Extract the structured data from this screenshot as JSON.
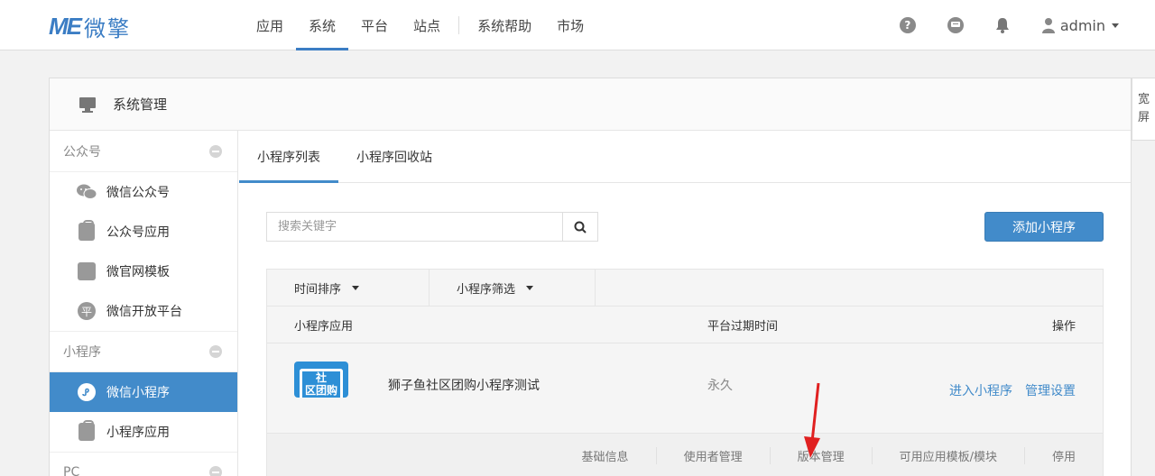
{
  "header": {
    "logo_mark": "ME",
    "logo_text": "微擎",
    "nav": [
      "应用",
      "系统",
      "平台",
      "站点",
      "系统帮助",
      "市场"
    ],
    "active_nav": "系统",
    "user": "admin",
    "help_glyph": "?",
    "icons": [
      "question-icon",
      "message-icon",
      "bell-icon",
      "user-icon"
    ]
  },
  "panel": {
    "title": "系统管理"
  },
  "sidebar": {
    "groups": [
      {
        "label": "公众号",
        "items": [
          {
            "label": "微信公众号",
            "icon": "wechat-icon"
          },
          {
            "label": "公众号应用",
            "icon": "bag-icon"
          },
          {
            "label": "微官网模板",
            "icon": "template-icon"
          },
          {
            "label": "微信开放平台",
            "icon": "platform-icon",
            "glyph": "平"
          }
        ]
      },
      {
        "label": "小程序",
        "items": [
          {
            "label": "微信小程序",
            "icon": "miniprogram-icon",
            "active": true
          },
          {
            "label": "小程序应用",
            "icon": "bag-icon"
          }
        ]
      },
      {
        "label": "PC",
        "items": []
      }
    ]
  },
  "tabs": [
    "小程序列表",
    "小程序回收站"
  ],
  "search": {
    "placeholder": "搜索关键字"
  },
  "add_button": "添加小程序",
  "filters": [
    "时间排序",
    "小程序筛选"
  ],
  "table": {
    "headers": [
      "小程序应用",
      "平台过期时间",
      "操作"
    ],
    "rows": [
      {
        "name": "狮子鱼社区团购小程序测试",
        "expire": "永久",
        "icon_text": "社\n区团购",
        "actions": [
          "进入小程序",
          "管理设置"
        ],
        "sub_actions": [
          "基础信息",
          "使用者管理",
          "版本管理",
          "可用应用模板/模块",
          "停用"
        ]
      }
    ]
  },
  "wide_toggle": [
    "宽",
    "屏"
  ],
  "colors": {
    "accent": "#428bca",
    "logo": "#3b7dc4",
    "annotation_arrow": "#e02020"
  }
}
